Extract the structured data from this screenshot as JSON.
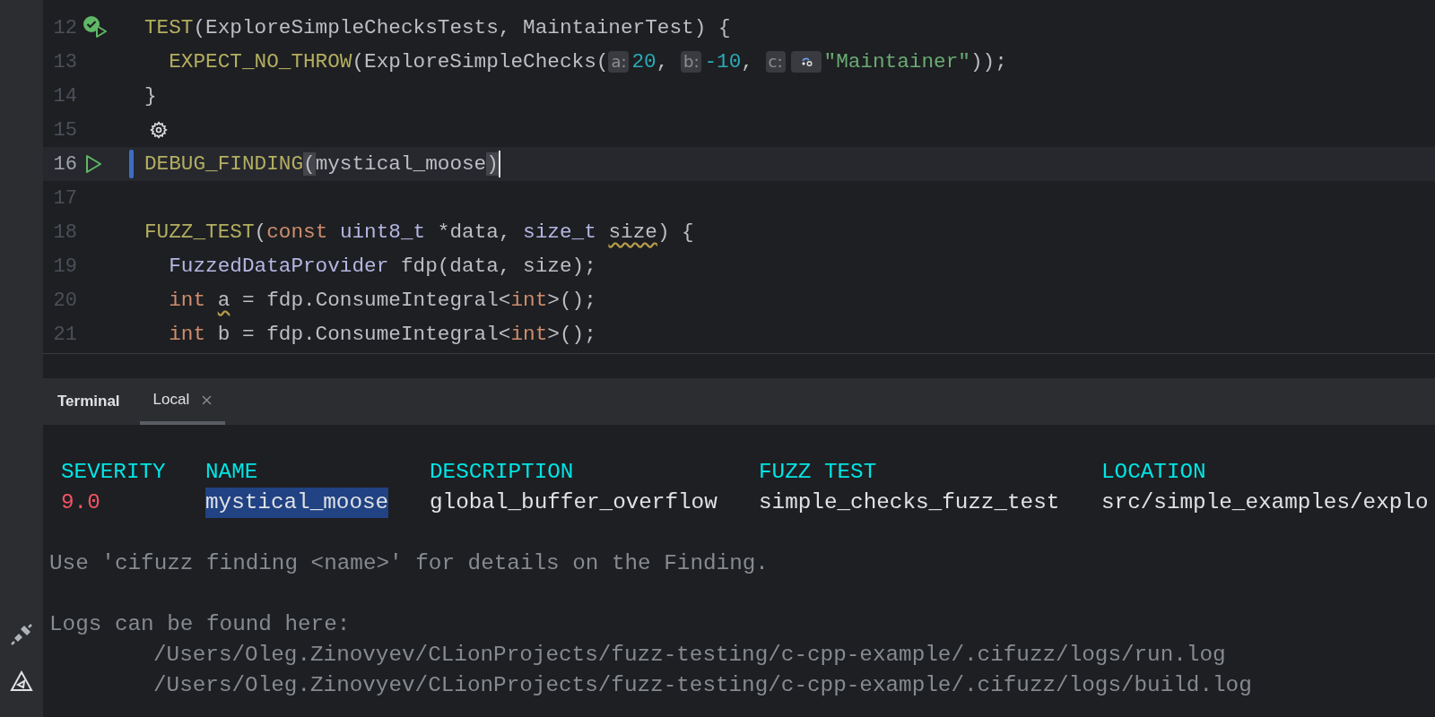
{
  "editor": {
    "lines": [
      {
        "number": "12",
        "current": false,
        "changed": false,
        "caret": false,
        "gutter_icon": {
          "kind": "test-passed"
        },
        "tokens": [
          {
            "kind": "macro",
            "text": "TEST"
          },
          {
            "kind": "plain",
            "text": "(ExploreSimpleChecksTests, MaintainerTest) {"
          }
        ]
      },
      {
        "number": "13",
        "current": false,
        "changed": false,
        "caret": false,
        "tokens": [
          {
            "kind": "macro",
            "text": "  EXPECT_NO_THROW"
          },
          {
            "kind": "plain",
            "text": "(ExploreSimpleChecks("
          },
          {
            "kind": "hint",
            "text": "a:"
          },
          {
            "kind": "number",
            "text": "20"
          },
          {
            "kind": "plain",
            "text": ", "
          },
          {
            "kind": "hint",
            "text": "b:"
          },
          {
            "kind": "number",
            "text": "-10"
          },
          {
            "kind": "plain",
            "text": ", "
          },
          {
            "kind": "hint",
            "text": "c:"
          },
          {
            "kind": "hint-icon"
          },
          {
            "kind": "string",
            "text": "\"Maintainer\""
          },
          {
            "kind": "plain",
            "text": "));"
          }
        ]
      },
      {
        "number": "14",
        "current": false,
        "changed": false,
        "caret": false,
        "tokens": [
          {
            "kind": "plain",
            "text": "}"
          }
        ]
      },
      {
        "number": "15",
        "current": false,
        "changed": false,
        "caret": false,
        "inline_icon": {
          "kind": "settings"
        }
      },
      {
        "number": "16",
        "current": true,
        "changed": true,
        "caret": true,
        "gutter_icon": {
          "kind": "run"
        },
        "tokens": [
          {
            "kind": "macro",
            "text": "DEBUG_FINDING"
          },
          {
            "kind": "plain",
            "text": "(",
            "matched": true
          },
          {
            "kind": "plain",
            "text": "mystical_moose",
            "matched": false
          },
          {
            "kind": "plain",
            "text": ")",
            "matched": true
          }
        ]
      },
      {
        "number": "17",
        "current": false,
        "changed": false,
        "caret": false
      },
      {
        "number": "18",
        "current": false,
        "changed": false,
        "caret": false,
        "tokens": [
          {
            "kind": "macro",
            "text": "FUZZ_TEST"
          },
          {
            "kind": "plain",
            "text": "("
          },
          {
            "kind": "keyword",
            "text": "const "
          },
          {
            "kind": "type",
            "text": "uint8_t"
          },
          {
            "kind": "plain",
            "text": " *data, "
          },
          {
            "kind": "type",
            "text": "size_t "
          },
          {
            "kind": "plain",
            "text": "size",
            "warning": true
          },
          {
            "kind": "plain",
            "text": ") {",
            "warning": false
          }
        ]
      },
      {
        "number": "19",
        "current": false,
        "changed": false,
        "caret": false,
        "tokens": [
          {
            "kind": "type",
            "text": "  FuzzedDataProvider"
          },
          {
            "kind": "plain",
            "text": " fdp(data, size);"
          }
        ]
      },
      {
        "number": "20",
        "current": false,
        "changed": false,
        "caret": false,
        "tokens": [
          {
            "kind": "keyword",
            "text": "  int "
          },
          {
            "kind": "plain",
            "text": "a",
            "warning": true
          },
          {
            "kind": "plain",
            "text": " = fdp.ConsumeIntegral<",
            "warning": false
          },
          {
            "kind": "keyword",
            "text": "int"
          },
          {
            "kind": "plain",
            "text": ">();"
          }
        ]
      },
      {
        "number": "21",
        "current": false,
        "changed": false,
        "caret": false,
        "tokens": [
          {
            "kind": "keyword",
            "text": "  int "
          },
          {
            "kind": "plain",
            "text": "b = fdp.ConsumeIntegral<"
          },
          {
            "kind": "keyword",
            "text": "int"
          },
          {
            "kind": "plain",
            "text": ">();"
          }
        ]
      }
    ]
  },
  "terminal": {
    "title": "Terminal",
    "tabs": [
      {
        "label": "Local",
        "selected": true,
        "closable": true
      }
    ],
    "table": {
      "columns": [
        {
          "header": "SEVERITY",
          "kind": "severity",
          "value": "9.0",
          "selected": false
        },
        {
          "header": "NAME",
          "kind": "text",
          "value": "mystical_moose",
          "selected": true
        },
        {
          "header": "DESCRIPTION",
          "kind": "text",
          "value": "global_buffer_overflow",
          "selected": false
        },
        {
          "header": "FUZZ TEST",
          "kind": "text",
          "value": "simple_checks_fuzz_test",
          "selected": false
        },
        {
          "header": "LOCATION",
          "kind": "text",
          "value": "src/simple_examples/explo",
          "selected": false
        }
      ]
    },
    "hint": "Use 'cifuzz finding <name>' for details on the Finding.",
    "logs": {
      "label": "Logs can be found here:",
      "paths": [
        "/Users/Oleg.Zinovyev/CLionProjects/fuzz-testing/c-cpp-example/.cifuzz/logs/run.log",
        "/Users/Oleg.Zinovyev/CLionProjects/fuzz-testing/c-cpp-example/.cifuzz/logs/build.log"
      ]
    }
  }
}
